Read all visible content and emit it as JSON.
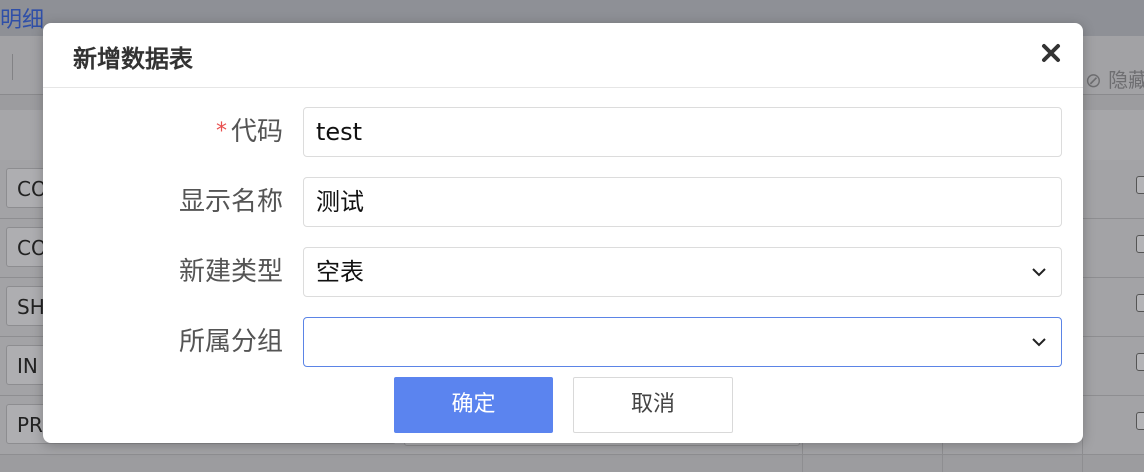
{
  "background": {
    "title_fragment": "明细",
    "hide_label": "隐藏",
    "rows": [
      "CO",
      "CO",
      "SH",
      "IN",
      "PR"
    ]
  },
  "dialog": {
    "title": "新增数据表",
    "close_icon": "close-icon",
    "required_mark": "*",
    "fields": {
      "code": {
        "label": "代码",
        "value": "test"
      },
      "display_name": {
        "label": "显示名称",
        "value": "测试"
      },
      "create_type": {
        "label": "新建类型",
        "value": "空表"
      },
      "group": {
        "label": "所属分组",
        "value": ""
      }
    },
    "buttons": {
      "ok": "确定",
      "cancel": "取消"
    }
  },
  "colors": {
    "primary": "#5b84ef",
    "required": "#e8504f",
    "overlay": "#9c9c9f"
  }
}
